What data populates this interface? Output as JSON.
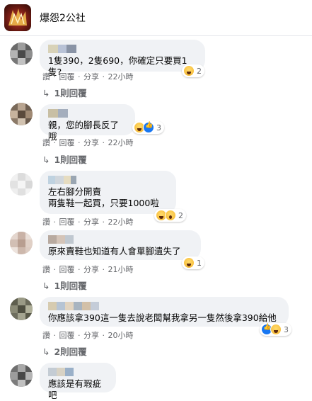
{
  "header": {
    "page_name": "爆怨2公社"
  },
  "actions": {
    "like": "讚",
    "reply": "回覆",
    "share": "分享",
    "sep": "·"
  },
  "comments": [
    {
      "text": "1隻390，2隻690，你確定只要買1隻?",
      "reaction_count": "2",
      "time": "22小時",
      "replies": "1則回覆"
    },
    {
      "text": "親，您的腳長反了哦",
      "reaction_count": "3",
      "time": "22小時",
      "replies": "1則回覆"
    },
    {
      "text": "左右腳分開賣\n兩隻鞋一起買，只要1000啦",
      "reaction_count": "2",
      "time": "22小時"
    },
    {
      "text": "原來賣鞋也知道有人會單腳遺失了",
      "reaction_count": "1",
      "time": "21小時",
      "replies": "1則回覆"
    },
    {
      "text": "你應該拿390這一隻去說老闆幫我拿另一隻然後拿390給他",
      "reaction_count": "3",
      "time": "20小時",
      "replies": "2則回覆"
    },
    {
      "text": "應該是有瑕疵吧"
    }
  ],
  "colors": {
    "bubble": "#f0f2f5",
    "meta": "#65676b",
    "like_blue": "#1877f2",
    "haha_yellow": "#f5b52e"
  },
  "icons": {
    "reply_arrow": "↳",
    "reactions": [
      "haha-icon",
      "like-icon",
      "wow-icon"
    ]
  }
}
